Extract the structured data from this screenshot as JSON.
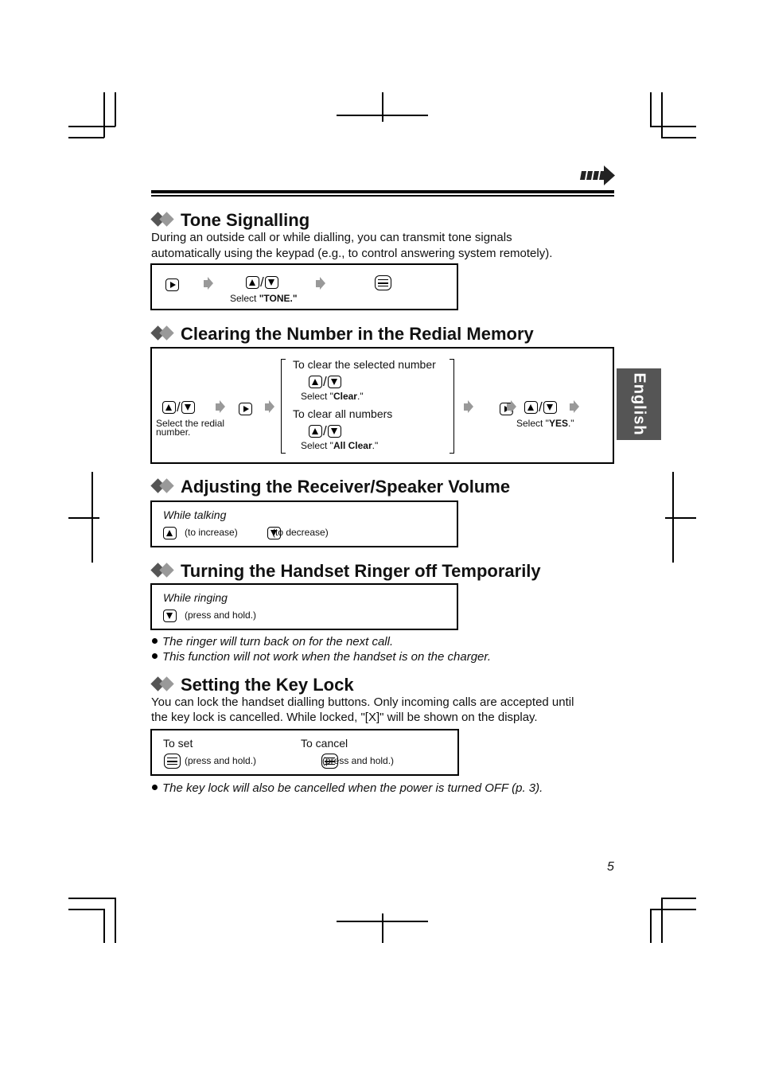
{
  "page": {
    "number": "5",
    "language_tab": "English",
    "continue_icon": "continue-arrow-icon"
  },
  "tone": {
    "title": "Tone Signalling",
    "desc_line1": "During an outside call or while dialling, you can transmit tone signals",
    "desc_line2": "automatically using the keypad (e.g., to control answering system remotely).",
    "select_prefix": "Select ",
    "select_value": "\"TONE.\""
  },
  "redial": {
    "title": "Clearing the Number in the Redial Memory",
    "select_redial_line1": "Select the redial",
    "select_redial_line2": "number.",
    "option1_title": "To clear the selected number",
    "option1_select_prefix": "Select \"",
    "option1_select_value": "Clear",
    "option1_select_suffix": ".\"",
    "option2_title": "To clear all numbers",
    "option2_select_prefix": "Select \"",
    "option2_select_value": "All Clear",
    "option2_select_suffix": ".\"",
    "confirm_prefix": "Select \"",
    "confirm_value": "YES",
    "confirm_suffix": ".\""
  },
  "volume": {
    "title": "Adjusting the Receiver/Speaker Volume",
    "context": "While talking",
    "increase": "(to increase)",
    "decrease": "(to decrease)"
  },
  "ringer": {
    "title": "Turning the Handset Ringer off Temporarily",
    "context": "While ringing",
    "action": "(press and hold.)",
    "notes": [
      "The ringer will turn back on for the next call.",
      "This function will not work when the handset is on the charger."
    ]
  },
  "keylock": {
    "title": "Setting the Key Lock",
    "desc_line1": "You can lock the handset dialling buttons. Only incoming calls are accepted until",
    "desc_line2": "the key lock is cancelled. While locked, \"[X]\" will be shown on the display.",
    "set_label": "To set",
    "set_action": "(press and hold.)",
    "cancel_label": "To cancel",
    "cancel_action": "(press and hold.)",
    "note": "The key lock will also be cancelled when the power is turned OFF (p. 3)."
  }
}
